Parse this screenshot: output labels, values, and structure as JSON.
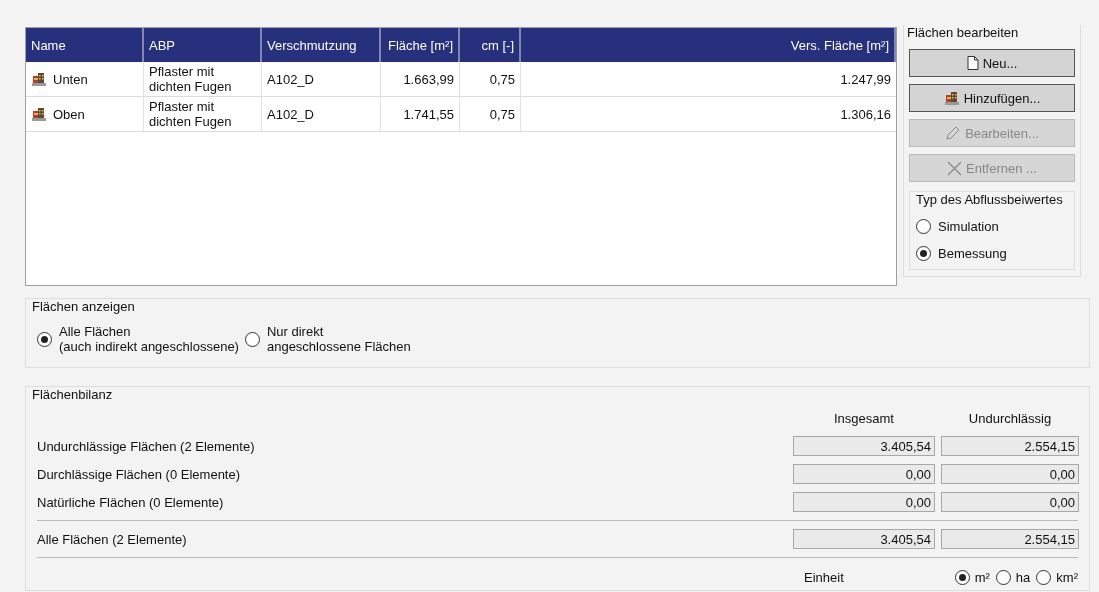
{
  "table": {
    "columns": [
      "Name",
      "ABP",
      "Verschmutzung",
      "Fläche [m²]",
      "cm [-]",
      "Vers. Fläche [m²]"
    ],
    "rows": [
      {
        "name": "Unten",
        "abp": "Pflaster mit\ndichten Fugen",
        "verschmutzung": "A102_D",
        "flaeche": "1.663,99",
        "cm": "0,75",
        "vers_flaeche": "1.247,99"
      },
      {
        "name": "Oben",
        "abp": "Pflaster mit\ndichten Fugen",
        "verschmutzung": "A102_D",
        "flaeche": "1.741,55",
        "cm": "0,75",
        "vers_flaeche": "1.306,16"
      }
    ]
  },
  "edit_panel": {
    "title": "Flächen bearbeiten",
    "buttons": [
      {
        "kind": "new",
        "label": "Neu...",
        "disabled": false
      },
      {
        "kind": "add",
        "label": "Hinzufügen...",
        "disabled": false
      },
      {
        "kind": "edit",
        "label": "Bearbeiten...",
        "disabled": true
      },
      {
        "kind": "remove",
        "label": "Entfernen ...",
        "disabled": true
      }
    ],
    "coefficient_type": {
      "title": "Typ des Abflussbeiwertes",
      "options": [
        {
          "label": "Simulation",
          "selected": false
        },
        {
          "label": "Bemessung",
          "selected": true
        }
      ]
    }
  },
  "display": {
    "title": "Flächen anzeigen",
    "options": [
      {
        "label": "Alle Flächen\n(auch indirekt angeschlossene)",
        "selected": true
      },
      {
        "label": "Nur direkt\nangeschlossene Flächen",
        "selected": false
      }
    ]
  },
  "balance": {
    "title": "Flächenbilanz",
    "columns": [
      "Insgesamt",
      "Undurchlässig"
    ],
    "rows": [
      {
        "label": "Undurchlässige Flächen (2 Elemente)",
        "total": "3.405,54",
        "impermeable": "2.554,15"
      },
      {
        "label": "Durchlässige Flächen (0 Elemente)",
        "total": "0,00",
        "impermeable": "0,00"
      },
      {
        "label": "Natürliche Flächen (0 Elemente)",
        "total": "0,00",
        "impermeable": "0,00"
      }
    ],
    "total_row": {
      "label": "Alle Flächen (2 Elemente)",
      "total": "3.405,54",
      "impermeable": "2.554,15"
    },
    "unit": {
      "label": "Einheit",
      "options": [
        {
          "label": "m²",
          "selected": true
        },
        {
          "label": "ha",
          "selected": false
        },
        {
          "label": "km²",
          "selected": false
        }
      ]
    }
  }
}
